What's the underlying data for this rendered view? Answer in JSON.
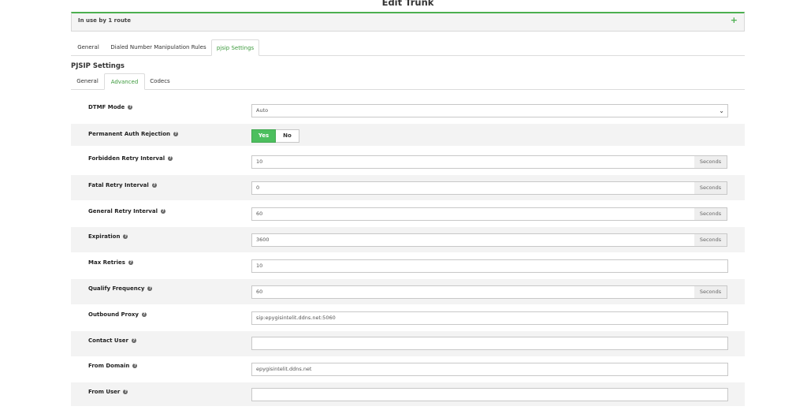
{
  "page_title": "Edit Trunk",
  "usage": {
    "text": "In use by 1 route",
    "plus": "+"
  },
  "top_tabs": [
    {
      "label": "General"
    },
    {
      "label": "Dialed Number Manipulation Rules"
    },
    {
      "label": "pjsip Settings",
      "active": true
    }
  ],
  "section_title": "PJSIP Settings",
  "sub_tabs": [
    {
      "label": "General"
    },
    {
      "label": "Advanced",
      "active": true
    },
    {
      "label": "Codecs"
    }
  ],
  "help_glyph": "?",
  "fields": {
    "dtmf_mode": {
      "label": "DTMF Mode",
      "value": "Auto",
      "chevron": "⌄"
    },
    "permanent_auth_rejection": {
      "label": "Permanent Auth Rejection",
      "yes": "Yes",
      "no": "No",
      "selected": "Yes"
    },
    "forbidden_retry_interval": {
      "label": "Forbidden Retry Interval",
      "value": "10",
      "addon": "Seconds"
    },
    "fatal_retry_interval": {
      "label": "Fatal Retry Interval",
      "value": "0",
      "addon": "Seconds"
    },
    "general_retry_interval": {
      "label": "General Retry Interval",
      "value": "60",
      "addon": "Seconds"
    },
    "expiration": {
      "label": "Expiration",
      "value": "3600",
      "addon": "Seconds"
    },
    "max_retries": {
      "label": "Max Retries",
      "value": "10"
    },
    "qualify_frequency": {
      "label": "Qualify Frequency",
      "value": "60",
      "addon": "Seconds"
    },
    "outbound_proxy": {
      "label": "Outbound Proxy",
      "value": "sip:epygisintelit.ddns.net:5060"
    },
    "contact_user": {
      "label": "Contact User",
      "value": ""
    },
    "from_domain": {
      "label": "From Domain",
      "value": "epygisintelit.ddns.net"
    },
    "from_user": {
      "label": "From User",
      "value": ""
    }
  },
  "colors": {
    "accent": "#4cbf5e",
    "active_tab_text": "#3c9a3c",
    "row_shade": "#f3f3f3"
  }
}
